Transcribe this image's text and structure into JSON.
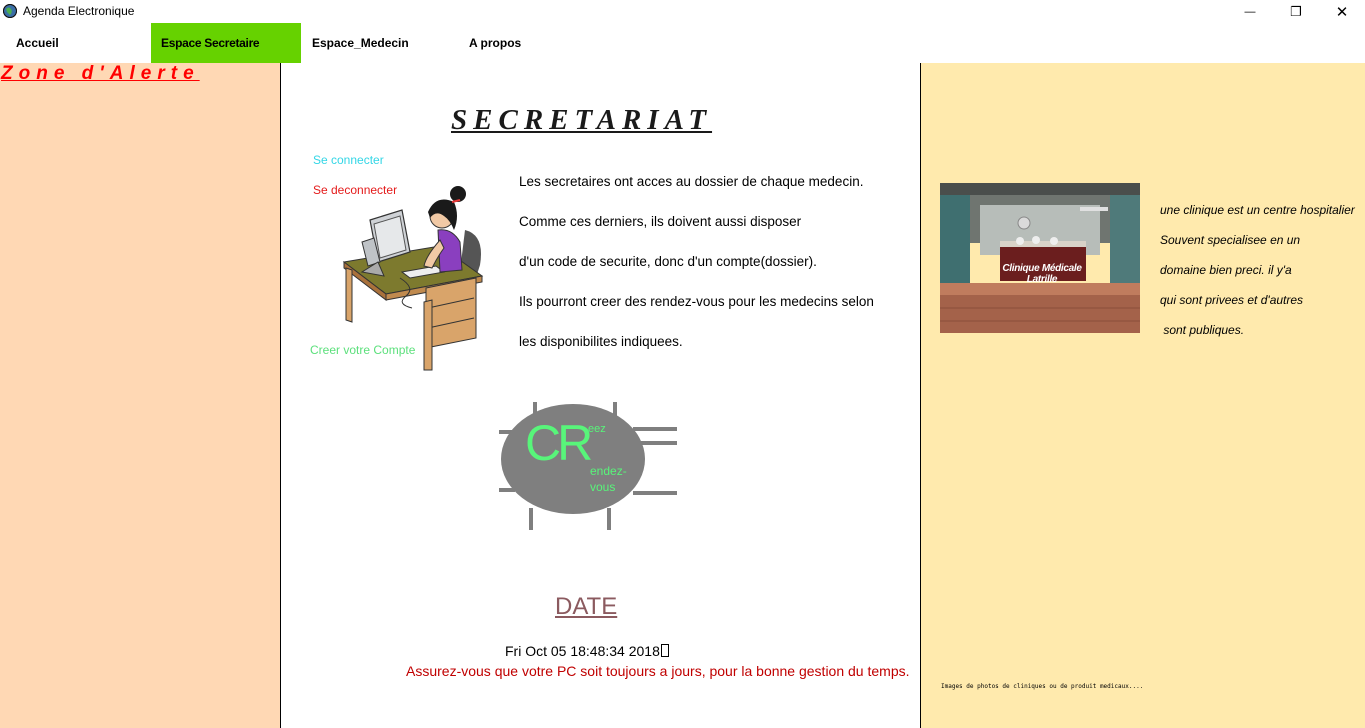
{
  "window": {
    "title": "Agenda Electronique",
    "minimize_glyph": "—",
    "restore_glyph": "❐",
    "close_glyph": "✕"
  },
  "menu": {
    "items": [
      {
        "label": "Accueil",
        "active": false
      },
      {
        "label": "Espace Secretaire",
        "active": true
      },
      {
        "label": "Espace_Medecin",
        "active": false
      },
      {
        "label": "A propos",
        "active": false
      }
    ],
    "active_color": "#66d200"
  },
  "left": {
    "alert_title": "Zone d'Alerte"
  },
  "center": {
    "heading": "SECRETARIAT",
    "links": {
      "connect": "Se connecter",
      "disconnect": "Se deconnecter",
      "create_account": "Creer votre Compte"
    },
    "paragraphs": [
      "Les secretaires ont acces au dossier de chaque medecin.",
      "Comme ces derniers, ils doivent aussi disposer",
      "d'un code de securite, donc d'un compte(dossier).",
      "Ils pourront creer des rendez-vous pour les medecins selon",
      "les disponibilites indiquees."
    ],
    "logo": {
      "big_letters": "CR",
      "small_top": "eez",
      "small_mid": "endez-",
      "small_bottom": "vous"
    },
    "date_label": "DATE",
    "date_value": "Fri Oct 05 18:48:34 2018",
    "warning": "Assurez-vous que votre PC soit toujours a jours, pour la bonne gestion du temps."
  },
  "right": {
    "photo_sign": "Clinique Médicale Latrille",
    "lines": [
      "une clinique est un centre hospitalier",
      "Souvent specialisee en un",
      "domaine bien preci. il y'a",
      "qui sont privees et d'autres",
      " sont publiques."
    ],
    "caption": "Images de photos de cliniques ou de produit medicaux...."
  },
  "icons": {
    "app": "globe-icon",
    "secretary_illustration": "secretary-at-desk-illustration",
    "clinic_photo": "clinic-reception-photo"
  },
  "colors": {
    "left_panel": "#ffd8b4",
    "right_panel": "#ffeaad",
    "alert": "#ff0000",
    "connect_link": "#33d6e6",
    "disconnect_link": "#e41a1a",
    "create_link": "#5ce07c",
    "logo_text": "#58f57a"
  }
}
